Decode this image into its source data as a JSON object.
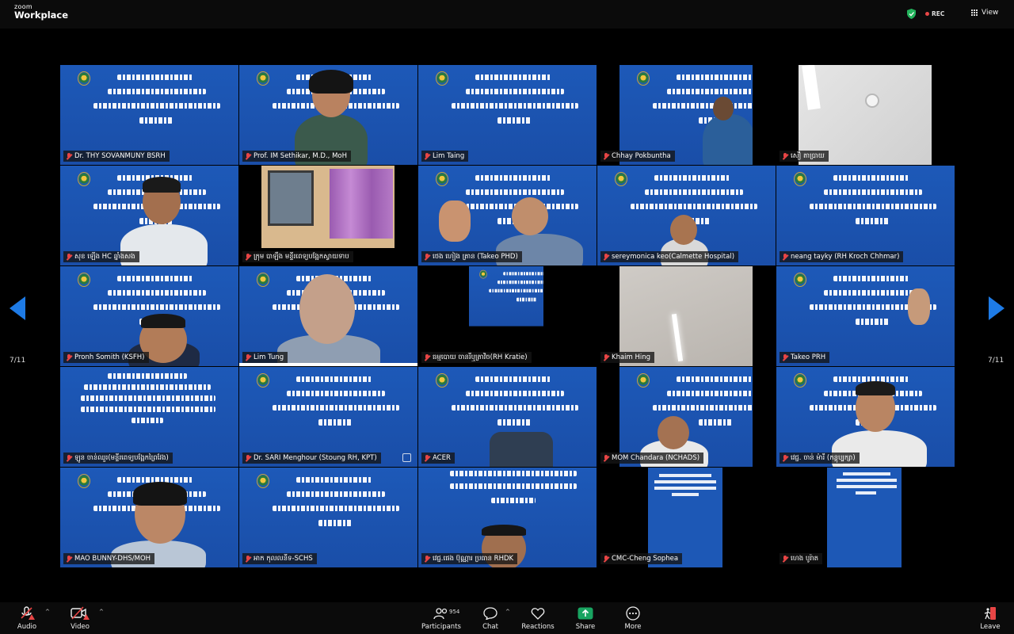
{
  "app": {
    "logo_small": "zoom",
    "logo_big": "Workplace"
  },
  "header": {
    "rec_label": "REC",
    "view_label": "View"
  },
  "pagination": {
    "left": "7/11",
    "right": "7/11"
  },
  "participants": [
    {
      "name": "Dr. THY SOVANMUNY BSRH"
    },
    {
      "name": "Prof. IM Sethikar, M.D., MoH"
    },
    {
      "name": "Lim Taing"
    },
    {
      "name": "Chhay Pokbuntha"
    },
    {
      "name": "សឿ តាប្រាយ"
    },
    {
      "name": "សុខ ឡើង HC ឆ្នាំងសង"
    },
    {
      "name": "ក្រុម បាឡឹង មន្ទីរពេទ្យបង្អែកស្វាយទាប"
    },
    {
      "name": "ថេង ហៀង ត្រាន (Takeo PHD)"
    },
    {
      "name": "sereymonica keo(Calmette Hospital)"
    },
    {
      "name": "neang tayky (RH Kroch Chhmar)"
    },
    {
      "name": "Pronh Somith (KSFH)"
    },
    {
      "name": "Lim Tung"
    },
    {
      "name": "ធម្មបោយ ចានរីឬត្រាវិច(RH Kratie)"
    },
    {
      "name": "Khaim Hing"
    },
    {
      "name": "Takeo PRH"
    },
    {
      "name": "ឡូន ចាន់ឈួរ(មន្ទីរពេទ្យបង្អែកព្រៃវែង)"
    },
    {
      "name": "Dr. SARI Menghour (Stoung RH, KPT)"
    },
    {
      "name": "ACER"
    },
    {
      "name": "MOM Chandara (NCHADS)"
    },
    {
      "name": "វេជ្ជ. ចាន់ ម៉ារី (កន្តុប្បក្សា)"
    },
    {
      "name": "MAO BUNNY-DHS/MOH"
    },
    {
      "name": "អាក កុលលនីទ-SCHS"
    },
    {
      "name": "វេជ្ជ.ផេង ប៊ុណ្ណារ ប្រធាន RHDK"
    },
    {
      "name": "CMC-Cheng Sophea"
    },
    {
      "name": "ហេង បូរ៉ាត"
    }
  ],
  "toolbar": {
    "audio": "Audio",
    "video": "Video",
    "participants": "Participants",
    "participant_count": "954",
    "chat": "Chat",
    "reactions": "Reactions",
    "share": "Share",
    "more": "More",
    "leave": "Leave"
  },
  "colors": {
    "accent": "#1e7be6",
    "muted_red": "#e84545",
    "share_green": "#19a461",
    "slide_blue": "#1b55af"
  }
}
